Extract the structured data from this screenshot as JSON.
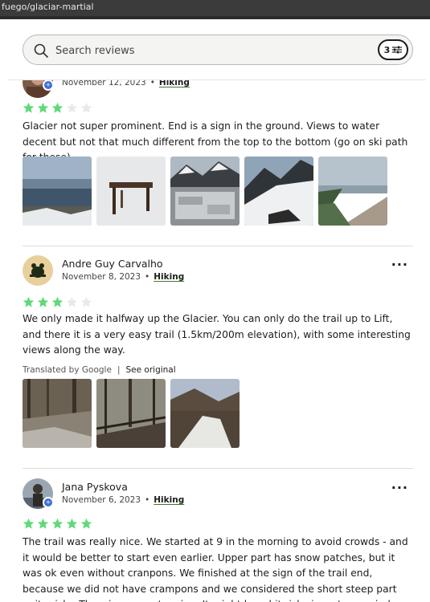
{
  "browser": {
    "url": "fuego/glaciar-martial"
  },
  "search": {
    "placeholder": "Search reviews",
    "filter_count": "3"
  },
  "colors": {
    "star_filled": "#5fd97a",
    "star_empty": "#e9e9e9",
    "accent_underline": "#3a7a2a",
    "badge": "#3d6fd8"
  },
  "reviews": [
    {
      "author": "",
      "date": "November 12, 2023",
      "activity": "Hiking",
      "rating": 3,
      "text": "Glacier not super prominent. End is a sign in the ground. Views to water decent but not that much different from the top to the bottom (go on ski path for these)",
      "photos": [
        "ushuaia-bay-view",
        "trail-end-sign-in-snow",
        "mountain-info-panel",
        "snowy-slope-rocks",
        "bay-overlook-path"
      ]
    },
    {
      "author": "Andre Guy Carvalho",
      "date": "November 8, 2023",
      "activity": "Hiking",
      "rating": 3,
      "text": "We only made it halfway up the Glacier. You can only do the trail up to Lift, and there it is a very easy trail (1.5km/200m elevation), with some interesting views along the way.",
      "translated_prefix": "Translated by",
      "translated_brand": "Google",
      "see_original": "See original",
      "photos": [
        "forest-stream",
        "forest-creek-logs",
        "snowy-valley"
      ]
    },
    {
      "author": "Jana Pyskova",
      "date": "November 6, 2023",
      "activity": "Hiking",
      "rating": 5,
      "text": "The trail was really nice. We started at 9 in the morning to avoid crowds - and it would be better to start even earlier. Upper part has snow patches, but it was ok even without cranpons. We finished at the sign of the trail end, because we did not have crampons and we considered the short steep part quite risky. The wiews are stunning. It might be a bit risky in a strong wind."
    }
  ]
}
